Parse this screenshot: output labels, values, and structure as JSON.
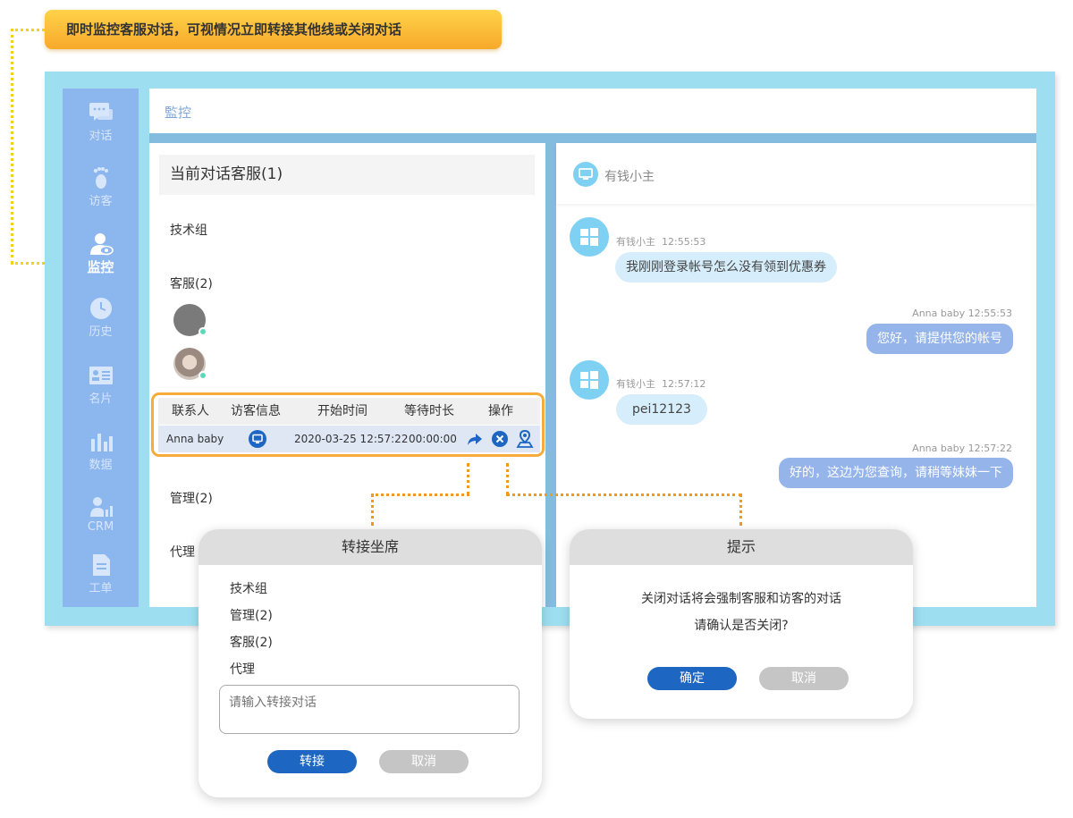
{
  "callout": {
    "text": "即时监控客服对话，可视情况立即转接其他线或关闭对话"
  },
  "sidebar": {
    "items": [
      {
        "label": "对话",
        "icon": "chat-icon"
      },
      {
        "label": "访客",
        "icon": "footprint-icon"
      },
      {
        "label": "监控",
        "icon": "monitor-user-icon",
        "active": true
      },
      {
        "label": "历史",
        "icon": "clock-icon"
      },
      {
        "label": "名片",
        "icon": "card-icon"
      },
      {
        "label": "数据",
        "icon": "bar-chart-icon"
      },
      {
        "label": "CRM",
        "icon": "crm-icon"
      },
      {
        "label": "工单",
        "icon": "document-icon"
      }
    ]
  },
  "header": {
    "breadcrumb": "監控"
  },
  "left": {
    "title": "当前对话客服(1)",
    "groups": [
      "技术组",
      "客服(2)",
      "管理(2)",
      "代理"
    ]
  },
  "table": {
    "columns": [
      "联系人",
      "访客信息",
      "开始时间",
      "等待时长",
      "操作"
    ],
    "row": {
      "contact": "Anna baby",
      "start": "2020-03-25 12:57:22",
      "wait": "00:00:00"
    }
  },
  "chat": {
    "visitor_name": "有钱小主",
    "messages": [
      {
        "from": "visitor",
        "name": "有钱小主",
        "time": "12:55:53",
        "text": "我刚刚登录帐号怎么没有领到优惠券"
      },
      {
        "from": "agent",
        "meta": "Anna baby 12:55:53",
        "text": "您好，请提供您的帐号"
      },
      {
        "from": "visitor",
        "name": "有钱小主",
        "time": "12:57:12",
        "text": "pei12123"
      },
      {
        "from": "agent",
        "meta": "Anna baby  12:57:22",
        "text": "好的，这边为您查询，请稍等妹妹一下"
      }
    ]
  },
  "transfer_dialog": {
    "title": "转接坐席",
    "options": [
      "技术组",
      "管理(2)",
      "客服(2)",
      "代理"
    ],
    "placeholder": "请输入转接对话",
    "confirm": "转接",
    "cancel": "取消"
  },
  "close_dialog": {
    "title": "提示",
    "line1": "关闭对话将会强制客服和访客的对话",
    "line2": "请确认是否关闭?",
    "confirm": "确定",
    "cancel": "取消"
  },
  "colors": {
    "accent": "#1d67c3",
    "sidebar": "#8cb6ee",
    "frame": "#9ddff0",
    "highlight": "#f6ac3a"
  }
}
